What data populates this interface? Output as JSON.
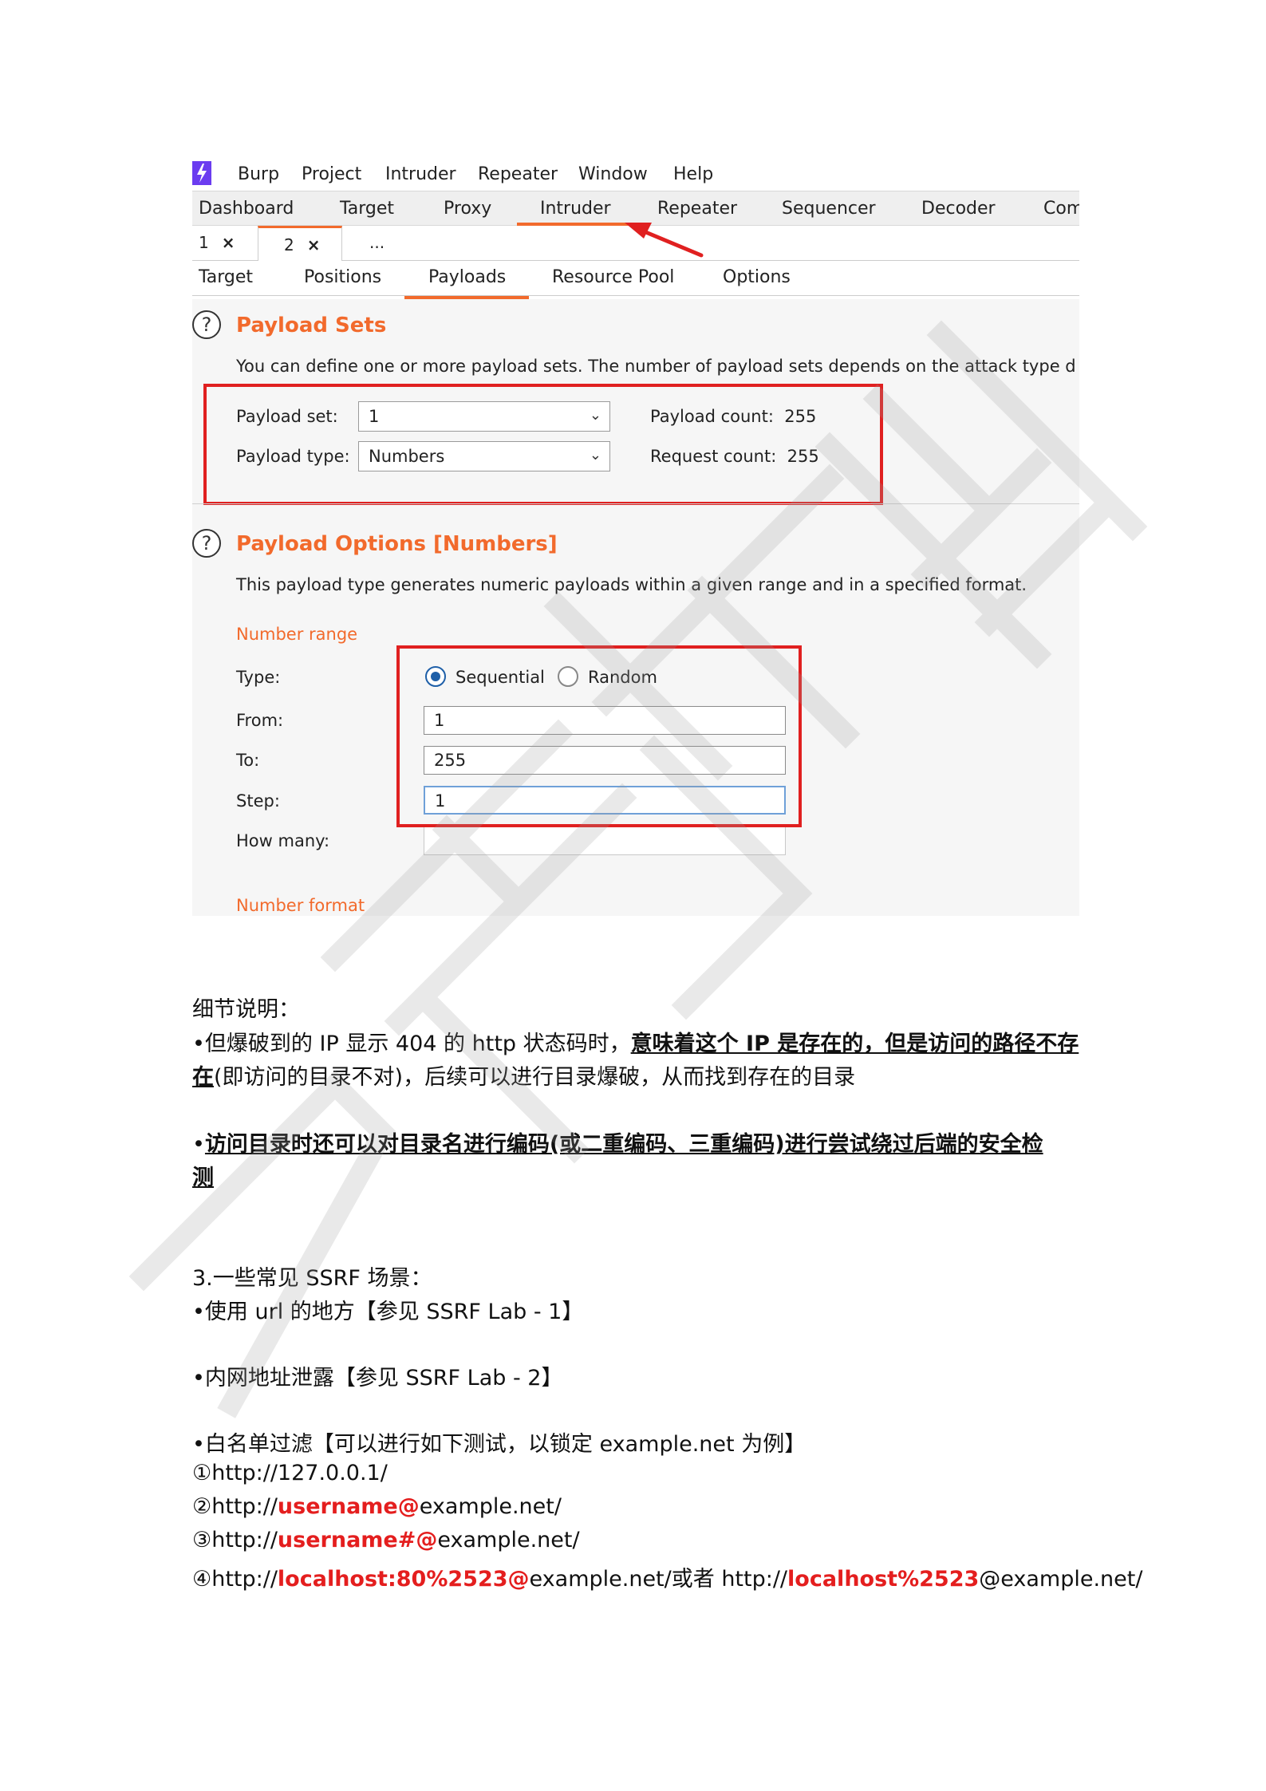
{
  "menubar": {
    "items": [
      "Burp",
      "Project",
      "Intruder",
      "Repeater",
      "Window",
      "Help"
    ]
  },
  "tool_tabs": [
    "Dashboard",
    "Target",
    "Proxy",
    "Intruder",
    "Repeater",
    "Sequencer",
    "Decoder",
    "Com"
  ],
  "instance_tabs": {
    "tab1": "1",
    "tab2": "2",
    "close": "×",
    "more": "..."
  },
  "sub_tabs": [
    "Target",
    "Positions",
    "Payloads",
    "Resource Pool",
    "Options"
  ],
  "payload_sets": {
    "title": "Payload Sets",
    "desc": "You can define one or more payload sets. The number of payload sets depends on the attack type d",
    "set_label": "Payload set:",
    "set_value": "1",
    "type_label": "Payload type:",
    "type_value": "Numbers",
    "count_label": "Payload count:",
    "count_value": "255",
    "request_label": "Request count:",
    "request_value": "255"
  },
  "payload_options": {
    "title": "Payload Options [Numbers]",
    "desc": "This payload type generates numeric payloads within a given range and in a specified format.",
    "range_label": "Number range",
    "type_label": "Type:",
    "sequential": "Sequential",
    "random": "Random",
    "from_label": "From:",
    "from_value": "1",
    "to_label": "To:",
    "to_value": "255",
    "step_label": "Step:",
    "step_value": "1",
    "howmany_label": "How many:",
    "format_label": "Number format"
  },
  "doc": {
    "detail_heading": "细节说明：",
    "p1_a": "•但爆破到的 IP 显示 404 的 http 状态码时，",
    "p1_b": "意味着这个 IP 是存在的，但是访问的路径不存",
    "p1_c": "在",
    "p1_d": "(即访问的目录不对)，后续可以进行目录爆破，从而找到存在的目录",
    "p2_bullet": "•",
    "p2_a": "访问目录时还可以对目录名进行编码(或二重编码、三重编码)进行尝试绕过后端的安全检",
    "p2_b": "测",
    "s3_heading": "3.一些常见 SSRF 场景：",
    "s3_item1": "•使用 url 的地方【参见 SSRF Lab - 1】",
    "s3_item2": "•内网地址泄露【参见 SSRF Lab - 2】",
    "s3_item3": "•白名单过滤【可以进行如下测试，以锁定 example.net 为例】",
    "l1": "①http://127.0.0.1/",
    "l2_pre": "②http://",
    "l2_red": "username@",
    "l2_post": "example.net/",
    "l3_pre": "③http://",
    "l3_red": "username#@",
    "l3_post": "example.net/",
    "l4_pre": "④http://",
    "l4_red": "localhost:80%2523@",
    "l4_mid": "example.net/或者 http://",
    "l4_red2": "localhost%2523",
    "l4_post": "@example.net/"
  },
  "colors": {
    "accent": "#f26a2c",
    "highlight_box": "#e02020",
    "emphasis_text": "#e41e1e",
    "radio": "#1e5fa8"
  }
}
